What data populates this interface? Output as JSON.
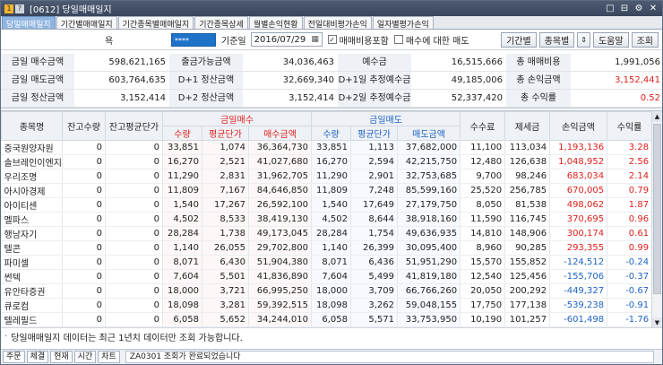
{
  "window": {
    "title": "[0612] 당일매매일지",
    "badge_one": "1",
    "badge_q": "?",
    "controls": [
      "□",
      "⊟",
      "⚙",
      "✕"
    ]
  },
  "tabs": [
    {
      "label": "당일매매일지",
      "active": true
    },
    {
      "label": "기간별매매일지"
    },
    {
      "label": "기간종목별매매일지"
    },
    {
      "label": "기간종목상세"
    },
    {
      "label": "월별손익현황"
    },
    {
      "label": "전일대비평가손익"
    },
    {
      "label": "일자별평가손익"
    }
  ],
  "toolbar": {
    "account_label": "욕",
    "account_value": "****",
    "date_label": "기준일",
    "date_value": "2016/07/29",
    "calendar_icon": "▦",
    "fee_checkbox_label": "매매비용포함",
    "fee_checked": true,
    "sell_checkbox_label": "매수에 대한 매도",
    "sell_checked": false,
    "btn_period": "기간별",
    "btn_stock": "종목별",
    "btn_updown": "⇕",
    "btn_help": "도움말",
    "btn_search": "조회"
  },
  "summary": {
    "rows": [
      [
        {
          "label": "금일 매수금액",
          "value": "598,621,165"
        },
        {
          "label": "출금가능금액",
          "value": "34,036,463"
        },
        {
          "label": "예수금",
          "value": "16,515,666"
        },
        {
          "label": "총 매매비용",
          "value": "1,991,056"
        }
      ],
      [
        {
          "label": "금일 매도금액",
          "value": "603,764,635"
        },
        {
          "label": "D+1 정산금액",
          "value": "32,669,340"
        },
        {
          "label": "D+1일 추정예수금",
          "value": "49,185,006"
        },
        {
          "label": "총 손익금액",
          "value": "3,152,441",
          "red": true
        }
      ],
      [
        {
          "label": "금일 정산금액",
          "value": "3,152,414"
        },
        {
          "label": "D+2 정산금액",
          "value": "3,152,414"
        },
        {
          "label": "D+2일 추정예수금",
          "value": "52,337,420"
        },
        {
          "label": "총 수익률",
          "value": "0.52",
          "red": true
        }
      ]
    ]
  },
  "table": {
    "headers": {
      "name": "종목명",
      "hold_qty": "잔고수량",
      "hold_avg": "잔고평균단가",
      "buy_group": "금일매수",
      "sell_group": "금일매도",
      "fee": "수수료",
      "tax": "제세금",
      "pnl": "손익금액",
      "rate": "수익률",
      "qty": "수량",
      "avg": "평균단가",
      "buy_amt": "매수금액",
      "sell_amt": "매도금액"
    },
    "rows": [
      {
        "name": "중국원양자원",
        "hq": "0",
        "ha": "0",
        "bq": "33,851",
        "ba": "1,074",
        "bm": "36,364,730",
        "sq": "33,851",
        "sa": "1,113",
        "sm": "37,682,000",
        "fee": "11,100",
        "tax": "113,034",
        "pnl": "1,193,136",
        "rate": "3.28",
        "pos": true
      },
      {
        "name": "솔브레인이엔지",
        "hq": "0",
        "ha": "0",
        "bq": "16,270",
        "ba": "2,521",
        "bm": "41,027,680",
        "sq": "16,270",
        "sa": "2,594",
        "sm": "42,215,750",
        "fee": "12,480",
        "tax": "126,638",
        "pnl": "1,048,952",
        "rate": "2.56",
        "pos": true
      },
      {
        "name": "우리조명",
        "hq": "0",
        "ha": "0",
        "bq": "11,290",
        "ba": "2,831",
        "bm": "31,962,705",
        "sq": "11,290",
        "sa": "2,901",
        "sm": "32,753,685",
        "fee": "9,700",
        "tax": "98,246",
        "pnl": "683,034",
        "rate": "2.14",
        "pos": true
      },
      {
        "name": "아시아경제",
        "hq": "0",
        "ha": "0",
        "bq": "11,809",
        "ba": "7,167",
        "bm": "84,646,850",
        "sq": "11,809",
        "sa": "7,248",
        "sm": "85,599,160",
        "fee": "25,520",
        "tax": "256,785",
        "pnl": "670,005",
        "rate": "0.79",
        "pos": true
      },
      {
        "name": "아이티센",
        "hq": "0",
        "ha": "0",
        "bq": "1,540",
        "ba": "17,267",
        "bm": "26,592,100",
        "sq": "1,540",
        "sa": "17,649",
        "sm": "27,179,750",
        "fee": "8,050",
        "tax": "81,538",
        "pnl": "498,062",
        "rate": "1.87",
        "pos": true
      },
      {
        "name": "멜파스",
        "hq": "0",
        "ha": "0",
        "bq": "4,502",
        "ba": "8,533",
        "bm": "38,419,130",
        "sq": "4,502",
        "sa": "8,644",
        "sm": "38,918,160",
        "fee": "11,590",
        "tax": "116,745",
        "pnl": "370,695",
        "rate": "0.96",
        "pos": true
      },
      {
        "name": "행남자기",
        "hq": "0",
        "ha": "0",
        "bq": "28,284",
        "ba": "1,738",
        "bm": "49,173,045",
        "sq": "28,284",
        "sa": "1,754",
        "sm": "49,636,935",
        "fee": "14,810",
        "tax": "148,906",
        "pnl": "300,174",
        "rate": "0.61",
        "pos": true
      },
      {
        "name": "텔콘",
        "hq": "0",
        "ha": "0",
        "bq": "1,140",
        "ba": "26,055",
        "bm": "29,702,800",
        "sq": "1,140",
        "sa": "26,399",
        "sm": "30,095,400",
        "fee": "8,960",
        "tax": "90,285",
        "pnl": "293,355",
        "rate": "0.99",
        "pos": true
      },
      {
        "name": "파미셀",
        "hq": "0",
        "ha": "0",
        "bq": "8,071",
        "ba": "6,430",
        "bm": "51,904,380",
        "sq": "8,071",
        "sa": "6,436",
        "sm": "51,951,290",
        "fee": "15,570",
        "tax": "155,852",
        "pnl": "-124,512",
        "rate": "-0.24",
        "pos": false
      },
      {
        "name": "썬텍",
        "hq": "0",
        "ha": "0",
        "bq": "7,604",
        "ba": "5,501",
        "bm": "41,836,890",
        "sq": "7,604",
        "sa": "5,499",
        "sm": "41,819,180",
        "fee": "12,540",
        "tax": "125,456",
        "pnl": "-155,706",
        "rate": "-0.37",
        "pos": false
      },
      {
        "name": "유안타증권",
        "hq": "0",
        "ha": "0",
        "bq": "18,000",
        "ba": "3,721",
        "bm": "66,995,250",
        "sq": "18,000",
        "sa": "3,709",
        "sm": "66,766,260",
        "fee": "20,050",
        "tax": "200,292",
        "pnl": "-449,327",
        "rate": "-0.67",
        "pos": false
      },
      {
        "name": "큐로컴",
        "hq": "0",
        "ha": "0",
        "bq": "18,098",
        "ba": "3,281",
        "bm": "59,392,515",
        "sq": "18,098",
        "sa": "3,262",
        "sm": "59,048,155",
        "fee": "17,750",
        "tax": "177,138",
        "pnl": "-539,238",
        "rate": "-0.91",
        "pos": false
      },
      {
        "name": "텔레필드",
        "hq": "0",
        "ha": "0",
        "bq": "6,058",
        "ba": "5,652",
        "bm": "34,244,010",
        "sq": "6,058",
        "sa": "5,571",
        "sm": "33,753,950",
        "fee": "10,190",
        "tax": "101,257",
        "pnl": "-601,498",
        "rate": "-1.76",
        "pos": false
      }
    ]
  },
  "scroll": {
    "up_icon": "▲",
    "down_icon": "▼"
  },
  "note": {
    "text": "당일매매일지 데이터는 최근 1년치 데이터만 조회 가능합니다.",
    "bullet": "·"
  },
  "statusbar": {
    "buttons": [
      "주문",
      "체결",
      "현재",
      "시간",
      "차트"
    ],
    "message": "ZA0301 조회가 완료되었습니다"
  }
}
